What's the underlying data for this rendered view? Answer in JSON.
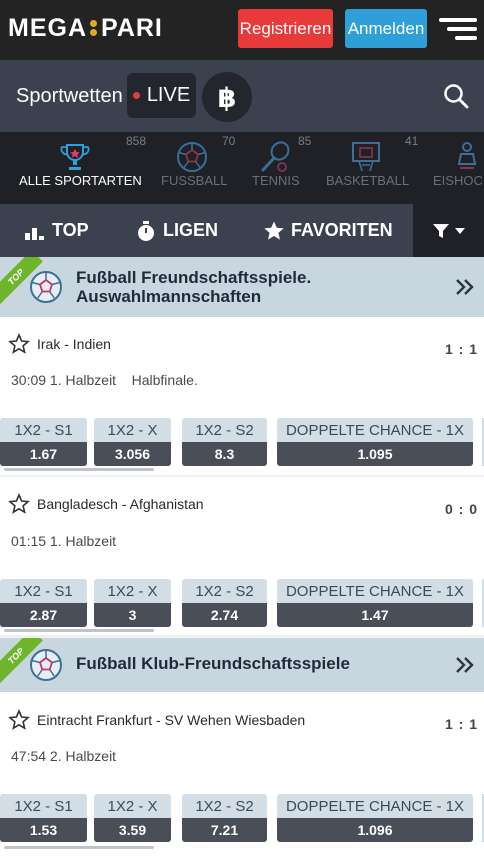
{
  "header": {
    "logo_left": "MEGA",
    "logo_right": "PARI",
    "register_label": "Registrieren",
    "login_label": "Anmelden"
  },
  "sportbar": {
    "title": "Sportwetten",
    "live_label": "LIVE"
  },
  "categories": [
    {
      "label": "ALLE SPORTARTEN",
      "count": "858",
      "icon": "trophy-icon",
      "active": true
    },
    {
      "label": "FUSSBALL",
      "count": "70",
      "icon": "football-icon"
    },
    {
      "label": "TENNIS",
      "count": "85",
      "icon": "tennis-icon"
    },
    {
      "label": "BASKETBALL",
      "count": "41",
      "icon": "basketball-icon"
    },
    {
      "label": "EISHOC",
      "count": "",
      "icon": "ice-hockey-icon"
    }
  ],
  "tabs": {
    "top": "TOP",
    "leagues": "LIGEN",
    "favorites": "FAVORITEN"
  },
  "leagues": [
    {
      "badge": "TOP",
      "title_line1": "Fußball Freundschaftsspiele.",
      "title_line2": "Auswahlmannschaften",
      "matches": [
        {
          "name": "Irak - Indien",
          "score": "1 : 1",
          "time": "30:09 1. Halbzeit    Halbfinale.",
          "odds": [
            {
              "label": "1X2 - S1",
              "value": "1.67"
            },
            {
              "label": "1X2 - X",
              "value": "3.056"
            },
            {
              "label": "1X2 - S2",
              "value": "8.3"
            },
            {
              "label": "DOPPELTE CHANCE - 1X",
              "value": "1.095"
            }
          ]
        },
        {
          "name": "Bangladesch - Afghanistan",
          "score": "0 : 0",
          "time": "01:15 1. Halbzeit",
          "odds": [
            {
              "label": "1X2 - S1",
              "value": "2.87"
            },
            {
              "label": "1X2 - X",
              "value": "3"
            },
            {
              "label": "1X2 - S2",
              "value": "2.74"
            },
            {
              "label": "DOPPELTE CHANCE - 1X",
              "value": "1.47"
            }
          ]
        }
      ]
    },
    {
      "badge": "TOP",
      "title_line1": "Fußball Klub-Freundschaftsspiele",
      "matches": [
        {
          "name": "Eintracht Frankfurt - SV Wehen Wiesbaden",
          "score": "1 : 1",
          "time": "47:54 2. Halbzeit",
          "odds": [
            {
              "label": "1X2 - S1",
              "value": "1.53"
            },
            {
              "label": "1X2 - X",
              "value": "3.59"
            },
            {
              "label": "1X2 - S2",
              "value": "7.21"
            },
            {
              "label": "DOPPELTE CHANCE - 1X",
              "value": "1.096"
            }
          ]
        }
      ]
    }
  ],
  "colors": {
    "register": "#e83a3a",
    "login": "#2e9fd8",
    "live_dot": "#e83a3a",
    "top_badge": "#6fb52c",
    "active_icon": "#2e9fd8"
  }
}
